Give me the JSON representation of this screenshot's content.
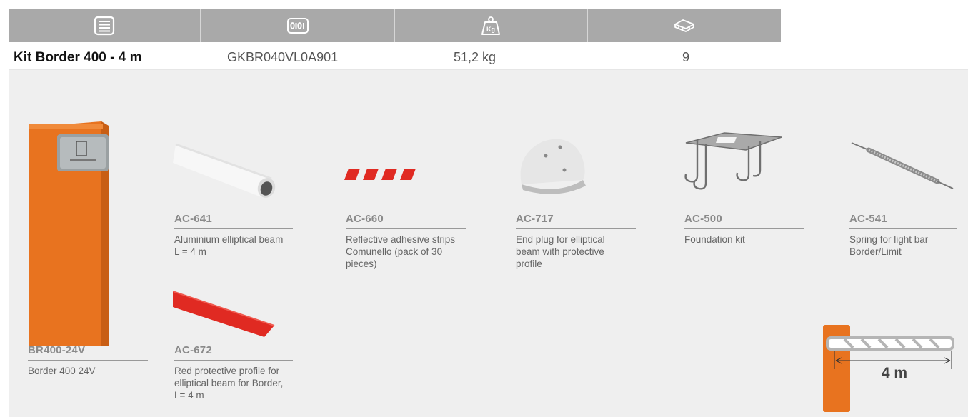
{
  "header": {
    "icons": [
      "list-icon",
      "barcode-binary-icon",
      "weight-kg-icon",
      "pallet-layers-icon"
    ],
    "kg_label": "Kg"
  },
  "info_row": {
    "kit_name": "Kit Border 400 - 4 m",
    "code": "GKBR040VL0A901",
    "weight": "51,2 kg",
    "quantity": "9"
  },
  "items": [
    {
      "code": "BR400-24V",
      "desc": [
        "Border 400 24V"
      ]
    },
    {
      "code": "AC-641",
      "desc": [
        "Aluminium elliptical beam",
        "L = 4 m"
      ]
    },
    {
      "code": "AC-672",
      "desc": [
        "Red protective profile for",
        "elliptical beam for Border,",
        "L= 4 m"
      ]
    },
    {
      "code": "AC-660",
      "desc": [
        "Reflective adhesive strips",
        "Comunello (pack of 30",
        "pieces)"
      ]
    },
    {
      "code": "AC-717",
      "desc": [
        "End plug for elliptical",
        "beam with protective",
        "profile"
      ]
    },
    {
      "code": "AC-500",
      "desc": [
        "Foundation kit"
      ]
    },
    {
      "code": "AC-541",
      "desc": [
        "Spring for light bar",
        "Border/Limit"
      ]
    }
  ],
  "diagram": {
    "length_label": "4 m"
  },
  "colors": {
    "header_bg": "#a9a9a9",
    "panel_bg": "#efefef",
    "orange": "#e8731f",
    "red": "#e02a22"
  }
}
